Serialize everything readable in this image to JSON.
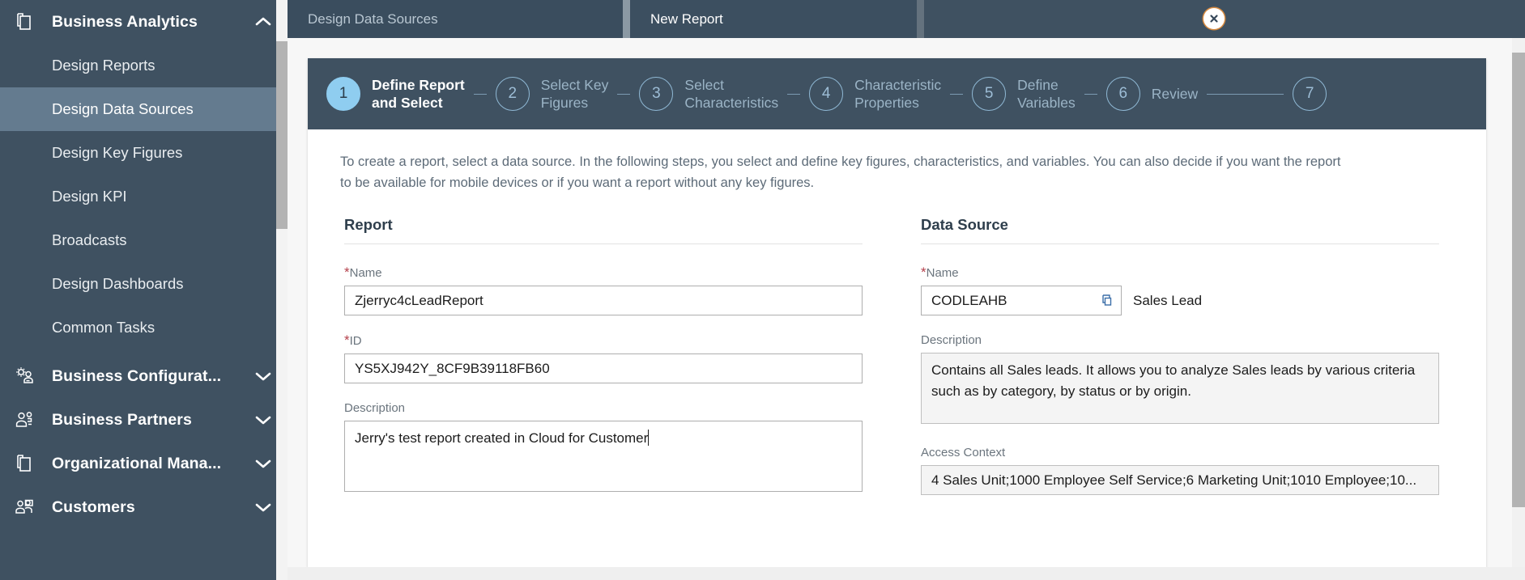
{
  "sidebar": {
    "groups": [
      {
        "label": "Business Analytics",
        "icon": "copy-documents-icon",
        "expanded": true,
        "chevron": "chevron-up-icon",
        "items": [
          {
            "label": "Design Reports",
            "selected": false
          },
          {
            "label": "Design Data Sources",
            "selected": true
          },
          {
            "label": "Design Key Figures",
            "selected": false
          },
          {
            "label": "Design KPI",
            "selected": false
          },
          {
            "label": "Broadcasts",
            "selected": false
          },
          {
            "label": "Design Dashboards",
            "selected": false
          },
          {
            "label": "Common Tasks",
            "selected": false
          }
        ]
      },
      {
        "label": "Business Configurat...",
        "icon": "gear-person-icon",
        "expanded": false,
        "chevron": "chevron-down-icon",
        "items": []
      },
      {
        "label": "Business Partners",
        "icon": "two-people-icon",
        "expanded": false,
        "chevron": "chevron-down-icon",
        "items": []
      },
      {
        "label": "Organizational Mana...",
        "icon": "copy-documents-icon",
        "expanded": false,
        "chevron": "chevron-down-icon",
        "items": []
      },
      {
        "label": "Customers",
        "icon": "people-group-icon",
        "expanded": false,
        "chevron": "chevron-down-icon",
        "items": []
      }
    ]
  },
  "tabs": {
    "inactive_label": "Design Data Sources",
    "active_label": "New Report",
    "close_icon": "close-icon"
  },
  "wizard": {
    "steps": [
      {
        "number": "1",
        "label": "Define Report\nand Select",
        "active": true
      },
      {
        "number": "2",
        "label": "Select Key\nFigures",
        "active": false
      },
      {
        "number": "3",
        "label": "Select\nCharacteristics",
        "active": false
      },
      {
        "number": "4",
        "label": "Characteristic\nProperties",
        "active": false
      },
      {
        "number": "5",
        "label": "Define\nVariables",
        "active": false
      },
      {
        "number": "6",
        "label": "Review",
        "active": false
      },
      {
        "number": "7",
        "label": "",
        "active": false
      }
    ]
  },
  "main": {
    "intro": "To create a report, select a data source. In the following steps, you select and define key figures, characteristics, and variables. You can also decide if you want the report to be available for mobile devices or if you want a report without any key figures.",
    "report": {
      "title": "Report",
      "name_label": "Name",
      "name_required": "*",
      "name_value": "Zjerryc4cLeadReport",
      "id_label": "ID",
      "id_required": "*",
      "id_value": "YS5XJ942Y_8CF9B39118FB60",
      "description_label": "Description",
      "description_value": "Jerry's test report created in Cloud for Customer"
    },
    "data_source": {
      "title": "Data Source",
      "name_label": "Name",
      "name_required": "*",
      "name_value": "CODLEAHB",
      "value_help_icon": "value-help-icon",
      "name_text": "Sales Lead",
      "description_label": "Description",
      "description_value": "Contains all Sales leads. It allows you to analyze Sales leads by various criteria such as by category, by status or by origin.",
      "access_context_label": "Access Context",
      "access_context_value": "4 Sales Unit;1000 Employee Self Service;6 Marketing Unit;1010 Employee;10..."
    }
  },
  "colors": {
    "sidebar_bg": "#3f5161",
    "sidebar_selected": "#647b8f",
    "wizard_bg": "#3f5161",
    "active_step": "#8fcdf0",
    "required_asterisk": "#b4404b"
  }
}
